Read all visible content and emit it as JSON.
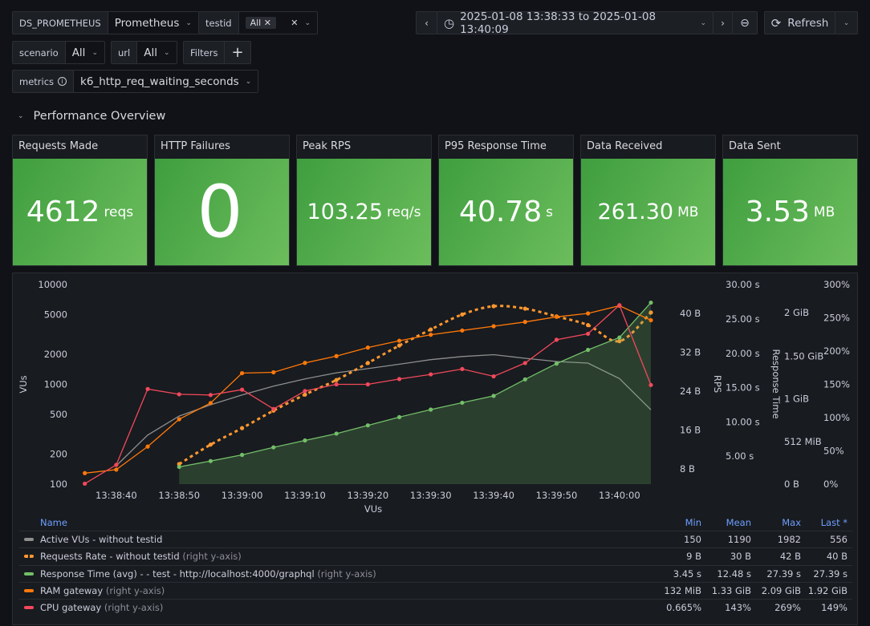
{
  "variables": {
    "ds": {
      "label": "DS_PROMETHEUS",
      "value": "Prometheus"
    },
    "testid": {
      "label": "testid",
      "value": "All"
    },
    "scenario": {
      "label": "scenario",
      "value": "All"
    },
    "url": {
      "label": "url",
      "value": "All"
    },
    "filters": {
      "label": "Filters",
      "add": "+"
    },
    "metrics": {
      "label": "metrics",
      "value": "k6_http_req_waiting_seconds"
    }
  },
  "timepicker": {
    "range": "2025-01-08 13:38:33 to 2025-01-08 13:40:09",
    "refresh": "Refresh"
  },
  "row": {
    "title": "Performance Overview"
  },
  "stats": [
    {
      "title": "Requests Made",
      "value": "4612",
      "unit": "reqs"
    },
    {
      "title": "HTTP Failures",
      "value": "0",
      "unit": ""
    },
    {
      "title": "Peak RPS",
      "value": "103.25",
      "unit": "req/s"
    },
    {
      "title": "P95 Response Time",
      "value": "40.78",
      "unit": "s"
    },
    {
      "title": "Data Received",
      "value": "261.30",
      "unit": "MB"
    },
    {
      "title": "Data Sent",
      "value": "3.53",
      "unit": "MB"
    }
  ],
  "colors": {
    "stat_green": "#56a64b",
    "vus": "#8e8e8e",
    "rps": "#ff9830",
    "resp": "#73bf69",
    "ram": "#ff780a",
    "cpu": "#f2495c"
  },
  "chart_data": {
    "type": "line",
    "xlabel": "VUs",
    "x_range": [
      "13:38:33",
      "13:40:05"
    ],
    "x_ticks": [
      "13:38:40",
      "13:38:50",
      "13:39:00",
      "13:39:10",
      "13:39:20",
      "13:39:30",
      "13:39:40",
      "13:39:50",
      "13:40:00"
    ],
    "axes": {
      "vus": {
        "label": "VUs",
        "scale": "log",
        "range": [
          100,
          10000
        ],
        "ticks": [
          [
            100,
            "100"
          ],
          [
            200,
            "200"
          ],
          [
            500,
            "500"
          ],
          [
            1000,
            "1000"
          ],
          [
            2000,
            "2000"
          ],
          [
            5000,
            "5000"
          ],
          [
            10000,
            "10000"
          ]
        ]
      },
      "bytes": {
        "label": "",
        "ticks": [
          [
            8,
            "8 B"
          ],
          [
            16,
            "16 B"
          ],
          [
            24,
            "24 B"
          ],
          [
            32,
            "32 B"
          ],
          [
            40,
            "40 B"
          ]
        ]
      },
      "seconds": {
        "label": "RPS",
        "range": [
          0,
          30
        ],
        "ticks": [
          [
            5,
            "5.00 s"
          ],
          [
            10,
            "10.00 s"
          ],
          [
            15,
            "15.00 s"
          ],
          [
            20,
            "20.00 s"
          ],
          [
            25,
            "25.00 s"
          ],
          [
            30,
            "30.00 s"
          ]
        ]
      },
      "gib": {
        "label": "Response Time",
        "range": [
          0,
          2.34
        ],
        "ticks": [
          [
            0,
            "0 B"
          ],
          [
            0.5,
            "512 MiB"
          ],
          [
            1,
            "1 GiB"
          ],
          [
            1.5,
            "1.50 GiB"
          ],
          [
            2,
            "2 GiB"
          ]
        ]
      },
      "percent": {
        "label": "",
        "range": [
          0,
          300
        ],
        "ticks": [
          [
            0,
            "0%"
          ],
          [
            50,
            "50%"
          ],
          [
            100,
            "100%"
          ],
          [
            150,
            "150%"
          ],
          [
            200,
            "200%"
          ],
          [
            250,
            "250%"
          ],
          [
            300,
            "300%"
          ]
        ]
      }
    },
    "times": [
      "13:38:35",
      "13:38:40",
      "13:38:45",
      "13:38:50",
      "13:38:55",
      "13:39:00",
      "13:39:05",
      "13:39:10",
      "13:39:15",
      "13:39:20",
      "13:39:25",
      "13:39:30",
      "13:39:35",
      "13:39:40",
      "13:39:45",
      "13:39:50",
      "13:39:55",
      "13:40:00",
      "13:40:05"
    ],
    "series": [
      {
        "name": "Active VUs - without testid",
        "suffix": "",
        "axis": "vus",
        "color": "#8e8e8e",
        "style": "line",
        "values": [
          null,
          153,
          310,
          481,
          624,
          783,
          958,
          1134,
          1306,
          1437,
          1592,
          1766,
          1901,
          1982,
          1824,
          1695,
          1633,
          1143,
          556
        ],
        "min": "150",
        "mean": "1190",
        "max": "1982",
        "last": "556"
      },
      {
        "name": "Requests Rate - without testid",
        "suffix": "(right y-axis)",
        "axis": "bytes",
        "color": "#ff9830",
        "style": "dashed",
        "values": [
          null,
          null,
          null,
          9,
          13,
          16.4,
          20,
          23.3,
          26.3,
          29.8,
          33.4,
          36.7,
          39.8,
          41.5,
          41,
          39.4,
          37.6,
          34.3,
          40.2
        ],
        "min": "9 B",
        "mean": "30 B",
        "max": "42 B",
        "last": "40 B"
      },
      {
        "name": "Response Time (avg) - - test - http://localhost:4000/graphql",
        "suffix": "(right y-axis)",
        "axis": "seconds",
        "color": "#73bf69",
        "style": "area",
        "values": [
          null,
          null,
          null,
          3.45,
          4.3,
          5.2,
          6.3,
          7.3,
          8.3,
          9.5,
          10.7,
          11.8,
          12.8,
          13.8,
          16.2,
          18.5,
          20.5,
          22.3,
          27.39
        ],
        "min": "3.45 s",
        "mean": "12.48 s",
        "max": "27.39 s",
        "last": "27.39 s"
      },
      {
        "name": "RAM gateway",
        "suffix": "(right y-axis)",
        "axis": "gib",
        "color": "#ff780a",
        "style": "line",
        "values": [
          0.129,
          0.17,
          0.44,
          0.76,
          0.95,
          1.3,
          1.31,
          1.42,
          1.5,
          1.6,
          1.68,
          1.75,
          1.8,
          1.85,
          1.9,
          1.96,
          2.0,
          2.09,
          1.92
        ],
        "min": "132 MiB",
        "mean": "1.33 GiB",
        "max": "2.09 GiB",
        "last": "1.92 GiB"
      },
      {
        "name": "CPU gateway",
        "suffix": "(right y-axis)",
        "axis": "percent",
        "color": "#f2495c",
        "style": "line",
        "values": [
          0.665,
          29,
          143,
          135,
          134,
          142,
          113,
          140,
          150,
          150,
          158,
          165,
          173,
          162,
          182,
          217,
          226,
          269,
          149
        ],
        "min": "0.665%",
        "mean": "143%",
        "max": "269%",
        "last": "149%"
      }
    ],
    "legend": {
      "placement": "bottom",
      "columns": [
        "Name",
        "Min",
        "Mean",
        "Max",
        "Last *"
      ]
    }
  }
}
